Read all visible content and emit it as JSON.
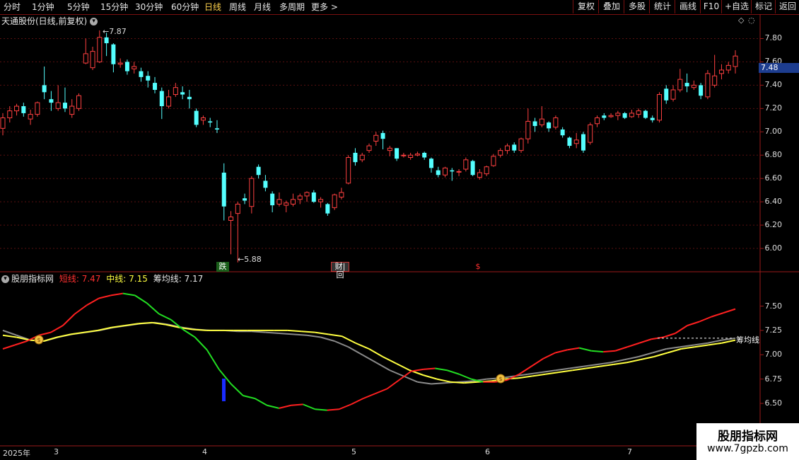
{
  "toolbar": {
    "periods": [
      "分时",
      "1分钟",
      "5分钟",
      "15分钟",
      "30分钟",
      "60分钟",
      "日线",
      "周线",
      "月线",
      "多周期",
      "更多 >"
    ],
    "active_period": "日线",
    "buttons": [
      "复权",
      "叠加",
      "多股",
      "统计",
      "画线",
      "F10",
      "+自选",
      "标记",
      "返回"
    ]
  },
  "stock": {
    "title": "天通股份(日线,前复权)"
  },
  "price_axis": [
    "7.80",
    "7.60",
    "7.40",
    "7.20",
    "7.00",
    "6.80",
    "6.60",
    "6.40",
    "6.20",
    "6.00"
  ],
  "current_price": "7.48",
  "annotations": {
    "high": "7.87",
    "low": "5.88"
  },
  "markers": {
    "die": "跌",
    "cai": "财|回",
    "s": "$"
  },
  "indicator": {
    "name": "股朋指标网",
    "short_label": "短线:",
    "short_value": "7.47",
    "mid_label": "中线:",
    "mid_value": "7.15",
    "chip_label": "筹均线:",
    "chip_value": "7.17",
    "axis": [
      "7.50",
      "7.25",
      "7.00",
      "6.75",
      "6.50",
      "6.25"
    ],
    "chip_tag": "筹均线"
  },
  "dates": {
    "year": "2025年",
    "months": [
      "3",
      "4",
      "5",
      "6",
      "7"
    ]
  },
  "watermark": {
    "line1": "股朋指标网",
    "line2": "www.7gpzb.com"
  },
  "colors": {
    "up": "#ff4040",
    "down": "#54ffff",
    "short_up": "#ff2020",
    "short_down": "#22dd22",
    "mid": "#ffff40",
    "chip": "#8a8a8a"
  },
  "chart_data": {
    "type": "candlestick",
    "candles": [
      {
        "o": 7.03,
        "c": 7.12,
        "h": 7.16,
        "l": 6.97
      },
      {
        "o": 7.12,
        "c": 7.18,
        "h": 7.22,
        "l": 7.08
      },
      {
        "o": 7.18,
        "c": 7.22,
        "h": 7.24,
        "l": 7.14
      },
      {
        "o": 7.22,
        "c": 7.16,
        "h": 7.25,
        "l": 7.13
      },
      {
        "o": 7.11,
        "c": 7.15,
        "h": 7.19,
        "l": 7.06
      },
      {
        "o": 7.15,
        "c": 7.25,
        "h": 7.26,
        "l": 7.13
      },
      {
        "o": 7.4,
        "c": 7.34,
        "h": 7.56,
        "l": 7.28
      },
      {
        "o": 7.28,
        "c": 7.25,
        "h": 7.35,
        "l": 7.18
      },
      {
        "o": 7.2,
        "c": 7.25,
        "h": 7.4,
        "l": 7.18
      },
      {
        "o": 7.25,
        "c": 7.2,
        "h": 7.38,
        "l": 7.17
      },
      {
        "o": 7.15,
        "c": 7.22,
        "h": 7.28,
        "l": 7.12
      },
      {
        "o": 7.2,
        "c": 7.31,
        "h": 7.33,
        "l": 7.18
      },
      {
        "o": 7.59,
        "c": 7.67,
        "h": 7.8,
        "l": 7.58
      },
      {
        "o": 7.55,
        "c": 7.69,
        "h": 7.73,
        "l": 7.53
      },
      {
        "o": 7.6,
        "c": 7.81,
        "h": 7.87,
        "l": 7.59
      },
      {
        "o": 7.81,
        "c": 7.76,
        "h": 7.85,
        "l": 7.65
      },
      {
        "o": 7.75,
        "c": 7.58,
        "h": 7.76,
        "l": 7.51
      },
      {
        "o": 7.58,
        "c": 7.59,
        "h": 7.63,
        "l": 7.55
      },
      {
        "o": 7.6,
        "c": 7.52,
        "h": 7.62,
        "l": 7.49
      },
      {
        "o": 7.54,
        "c": 7.56,
        "h": 7.6,
        "l": 7.5
      },
      {
        "o": 7.52,
        "c": 7.47,
        "h": 7.55,
        "l": 7.43
      },
      {
        "o": 7.48,
        "c": 7.44,
        "h": 7.52,
        "l": 7.38
      },
      {
        "o": 7.42,
        "c": 7.36,
        "h": 7.47,
        "l": 7.33
      },
      {
        "o": 7.35,
        "c": 7.22,
        "h": 7.38,
        "l": 7.11
      },
      {
        "o": 7.22,
        "c": 7.3,
        "h": 7.36,
        "l": 7.2
      },
      {
        "o": 7.32,
        "c": 7.38,
        "h": 7.42,
        "l": 7.3
      },
      {
        "o": 7.34,
        "c": 7.32,
        "h": 7.39,
        "l": 7.28
      },
      {
        "o": 7.3,
        "c": 7.28,
        "h": 7.36,
        "l": 7.2
      },
      {
        "o": 7.18,
        "c": 7.06,
        "h": 7.2,
        "l": 7.04
      },
      {
        "o": 7.1,
        "c": 7.12,
        "h": 7.14,
        "l": 7.06
      },
      {
        "o": 7.09,
        "c": 7.08,
        "h": 7.12,
        "l": 7.04
      },
      {
        "o": 7.03,
        "c": 7.02,
        "h": 7.1,
        "l": 6.99
      },
      {
        "o": 6.65,
        "c": 6.36,
        "h": 6.73,
        "l": 6.24
      },
      {
        "o": 6.24,
        "c": 6.27,
        "h": 6.32,
        "l": 5.95
      },
      {
        "o": 6.3,
        "c": 6.38,
        "h": 6.4,
        "l": 5.88
      },
      {
        "o": 6.43,
        "c": 6.41,
        "h": 6.47,
        "l": 6.38
      },
      {
        "o": 6.36,
        "c": 6.6,
        "h": 6.62,
        "l": 6.3
      },
      {
        "o": 6.7,
        "c": 6.63,
        "h": 6.72,
        "l": 6.6
      },
      {
        "o": 6.58,
        "c": 6.52,
        "h": 6.63,
        "l": 6.49
      },
      {
        "o": 6.47,
        "c": 6.37,
        "h": 6.49,
        "l": 6.31
      },
      {
        "o": 6.38,
        "c": 6.42,
        "h": 6.48,
        "l": 6.36
      },
      {
        "o": 6.37,
        "c": 6.39,
        "h": 6.41,
        "l": 6.31
      },
      {
        "o": 6.38,
        "c": 6.42,
        "h": 6.47,
        "l": 6.36
      },
      {
        "o": 6.42,
        "c": 6.45,
        "h": 6.47,
        "l": 6.38
      },
      {
        "o": 6.45,
        "c": 6.48,
        "h": 6.49,
        "l": 6.4
      },
      {
        "o": 6.48,
        "c": 6.4,
        "h": 6.5,
        "l": 6.39
      },
      {
        "o": 6.4,
        "c": 6.42,
        "h": 6.44,
        "l": 6.35
      },
      {
        "o": 6.38,
        "c": 6.3,
        "h": 6.39,
        "l": 6.28
      },
      {
        "o": 6.35,
        "c": 6.46,
        "h": 6.47,
        "l": 6.33
      },
      {
        "o": 6.44,
        "c": 6.48,
        "h": 6.52,
        "l": 6.42
      },
      {
        "o": 6.56,
        "c": 6.78,
        "h": 6.8,
        "l": 6.55
      },
      {
        "o": 6.82,
        "c": 6.74,
        "h": 6.86,
        "l": 6.71
      },
      {
        "o": 6.76,
        "c": 6.8,
        "h": 6.82,
        "l": 6.74
      },
      {
        "o": 6.84,
        "c": 6.88,
        "h": 6.9,
        "l": 6.82
      },
      {
        "o": 6.92,
        "c": 6.97,
        "h": 7.0,
        "l": 6.88
      },
      {
        "o": 6.99,
        "c": 6.94,
        "h": 7.01,
        "l": 6.85
      },
      {
        "o": 6.84,
        "c": 6.86,
        "h": 6.88,
        "l": 6.79
      },
      {
        "o": 6.86,
        "c": 6.77,
        "h": 6.86,
        "l": 6.75
      },
      {
        "o": 6.8,
        "c": 6.8,
        "h": 6.82,
        "l": 6.78
      },
      {
        "o": 6.78,
        "c": 6.8,
        "h": 6.82,
        "l": 6.76
      },
      {
        "o": 6.8,
        "c": 6.81,
        "h": 6.83,
        "l": 6.79
      },
      {
        "o": 6.82,
        "c": 6.78,
        "h": 6.83,
        "l": 6.76
      },
      {
        "o": 6.77,
        "c": 6.69,
        "h": 6.78,
        "l": 6.65
      },
      {
        "o": 6.67,
        "c": 6.63,
        "h": 6.7,
        "l": 6.61
      },
      {
        "o": 6.63,
        "c": 6.69,
        "h": 6.7,
        "l": 6.61
      },
      {
        "o": 6.67,
        "c": 6.66,
        "h": 6.69,
        "l": 6.58
      },
      {
        "o": 6.66,
        "c": 6.66,
        "h": 6.68,
        "l": 6.62
      },
      {
        "o": 6.68,
        "c": 6.76,
        "h": 6.78,
        "l": 6.66
      },
      {
        "o": 6.75,
        "c": 6.63,
        "h": 6.76,
        "l": 6.62
      },
      {
        "o": 6.61,
        "c": 6.65,
        "h": 6.68,
        "l": 6.59
      },
      {
        "o": 6.64,
        "c": 6.7,
        "h": 6.71,
        "l": 6.62
      },
      {
        "o": 6.71,
        "c": 6.79,
        "h": 6.81,
        "l": 6.7
      },
      {
        "o": 6.8,
        "c": 6.84,
        "h": 6.86,
        "l": 6.78
      },
      {
        "o": 6.84,
        "c": 6.88,
        "h": 6.9,
        "l": 6.81
      },
      {
        "o": 6.89,
        "c": 6.84,
        "h": 6.91,
        "l": 6.82
      },
      {
        "o": 6.84,
        "c": 6.94,
        "h": 6.95,
        "l": 6.82
      },
      {
        "o": 6.94,
        "c": 7.09,
        "h": 7.2,
        "l": 6.9
      },
      {
        "o": 7.09,
        "c": 7.05,
        "h": 7.12,
        "l": 7.0
      },
      {
        "o": 7.06,
        "c": 7.11,
        "h": 7.22,
        "l": 7.04
      },
      {
        "o": 7.08,
        "c": 7.03,
        "h": 7.09,
        "l": 7.0
      },
      {
        "o": 7.04,
        "c": 7.12,
        "h": 7.14,
        "l": 7.02
      },
      {
        "o": 7.02,
        "c": 6.97,
        "h": 7.04,
        "l": 6.95
      },
      {
        "o": 6.95,
        "c": 6.88,
        "h": 6.96,
        "l": 6.86
      },
      {
        "o": 6.9,
        "c": 6.93,
        "h": 6.99,
        "l": 6.86
      },
      {
        "o": 6.98,
        "c": 6.84,
        "h": 7.0,
        "l": 6.82
      },
      {
        "o": 6.91,
        "c": 7.06,
        "h": 7.08,
        "l": 6.89
      },
      {
        "o": 7.07,
        "c": 7.12,
        "h": 7.14,
        "l": 7.04
      },
      {
        "o": 7.14,
        "c": 7.12,
        "h": 7.16,
        "l": 7.1
      },
      {
        "o": 7.13,
        "c": 7.14,
        "h": 7.16,
        "l": 7.12
      },
      {
        "o": 7.14,
        "c": 7.16,
        "h": 7.18,
        "l": 7.1
      },
      {
        "o": 7.16,
        "c": 7.12,
        "h": 7.17,
        "l": 7.11
      },
      {
        "o": 7.13,
        "c": 7.16,
        "h": 7.19,
        "l": 7.12
      },
      {
        "o": 7.15,
        "c": 7.18,
        "h": 7.2,
        "l": 7.12
      },
      {
        "o": 7.18,
        "c": 7.12,
        "h": 7.19,
        "l": 7.11
      },
      {
        "o": 7.12,
        "c": 7.1,
        "h": 7.14,
        "l": 7.08
      },
      {
        "o": 7.1,
        "c": 7.32,
        "h": 7.34,
        "l": 7.08
      },
      {
        "o": 7.37,
        "c": 7.27,
        "h": 7.4,
        "l": 7.24
      },
      {
        "o": 7.28,
        "c": 7.36,
        "h": 7.4,
        "l": 7.26
      },
      {
        "o": 7.36,
        "c": 7.45,
        "h": 7.54,
        "l": 7.34
      },
      {
        "o": 7.42,
        "c": 7.39,
        "h": 7.5,
        "l": 7.34
      },
      {
        "o": 7.38,
        "c": 7.4,
        "h": 7.44,
        "l": 7.36
      },
      {
        "o": 7.4,
        "c": 7.31,
        "h": 7.42,
        "l": 7.28
      },
      {
        "o": 7.3,
        "c": 7.5,
        "h": 7.53,
        "l": 7.28
      },
      {
        "o": 7.4,
        "c": 7.48,
        "h": 7.66,
        "l": 7.38
      },
      {
        "o": 7.5,
        "c": 7.53,
        "h": 7.58,
        "l": 7.45
      },
      {
        "o": 7.53,
        "c": 7.57,
        "h": 7.6,
        "l": 7.5
      },
      {
        "o": 7.56,
        "c": 7.65,
        "h": 7.7,
        "l": 7.5
      }
    ],
    "price_range": [
      5.8,
      7.9
    ],
    "indicator_range": [
      6.1,
      7.7
    ],
    "short_line": [
      7.06,
      7.1,
      7.14,
      7.2,
      7.23,
      7.3,
      7.42,
      7.51,
      7.58,
      7.61,
      7.63,
      7.61,
      7.53,
      7.42,
      7.36,
      7.26,
      7.18,
      7.05,
      6.85,
      6.7,
      6.58,
      6.55,
      6.48,
      6.45,
      6.48,
      6.49,
      6.44,
      6.43,
      6.44,
      6.49,
      6.55,
      6.6,
      6.65,
      6.74,
      6.83,
      6.85,
      6.86,
      6.84,
      6.8,
      6.75,
      6.72,
      6.72,
      6.74,
      6.8,
      6.88,
      6.96,
      7.02,
      7.05,
      7.07,
      7.04,
      7.03,
      7.04,
      7.08,
      7.12,
      7.16,
      7.18,
      7.22,
      7.3,
      7.34,
      7.39,
      7.43,
      7.47
    ],
    "mid_line": [
      7.2,
      7.18,
      7.15,
      7.14,
      7.18,
      7.21,
      7.23,
      7.25,
      7.28,
      7.3,
      7.32,
      7.33,
      7.31,
      7.28,
      7.26,
      7.25,
      7.25,
      7.25,
      7.25,
      7.25,
      7.25,
      7.25,
      7.24,
      7.23,
      7.21,
      7.19,
      7.12,
      7.06,
      6.98,
      6.91,
      6.84,
      6.79,
      6.75,
      6.72,
      6.71,
      6.72,
      6.73,
      6.75,
      6.76,
      6.78,
      6.8,
      6.82,
      6.84,
      6.86,
      6.88,
      6.9,
      6.92,
      6.95,
      6.98,
      7.02,
      7.06,
      7.08,
      7.1,
      7.12,
      7.15
    ],
    "chip_line": [
      7.25,
      7.2,
      7.15,
      7.14,
      7.18,
      7.21,
      7.23,
      7.25,
      7.28,
      7.3,
      7.32,
      7.33,
      7.31,
      7.28,
      7.26,
      7.25,
      7.25,
      7.24,
      7.24,
      7.23,
      7.22,
      7.21,
      7.2,
      7.18,
      7.14,
      7.08,
      7.0,
      6.92,
      6.84,
      6.78,
      6.72,
      6.7,
      6.71,
      6.72,
      6.73,
      6.75,
      6.76,
      6.78,
      6.8,
      6.82,
      6.84,
      6.86,
      6.88,
      6.9,
      6.92,
      6.95,
      6.98,
      7.02,
      7.06,
      7.08,
      7.1,
      7.12,
      7.15,
      7.17
    ]
  }
}
